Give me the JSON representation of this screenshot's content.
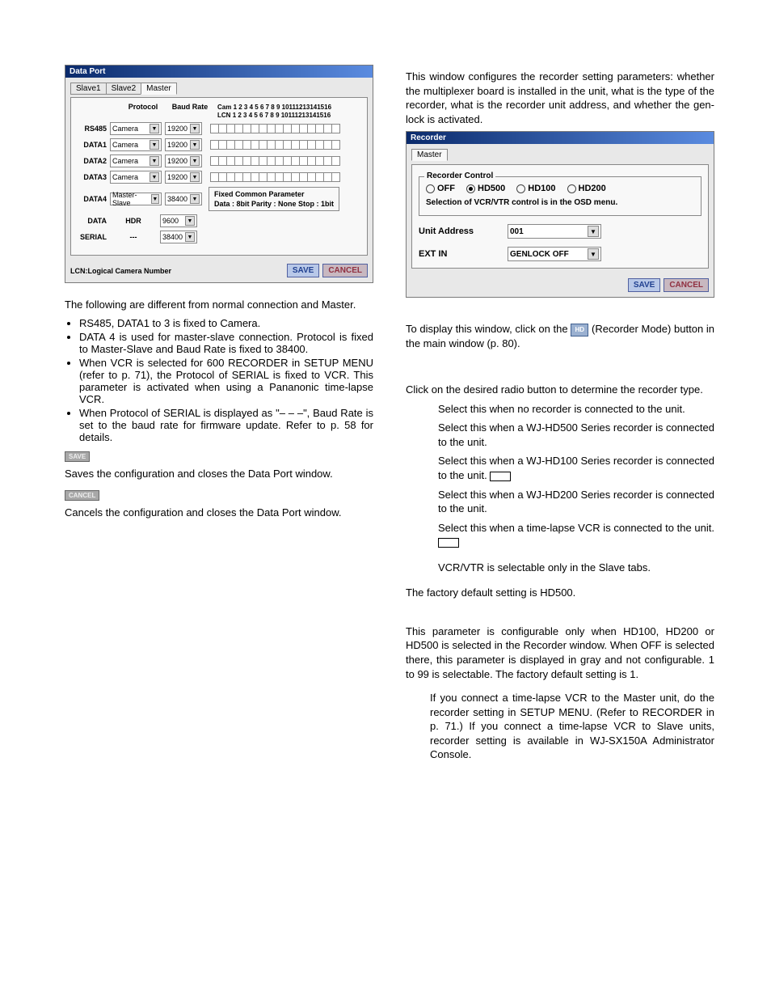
{
  "dataport_win": {
    "title": "Data Port",
    "tabs": [
      "Slave1",
      "Slave2",
      "Master"
    ],
    "headers": {
      "protocol": "Protocol",
      "baud": "Baud Rate",
      "cam": "Cam",
      "lcn": "LCN"
    },
    "cam_nums": "1  2  3  4  5  6  7  8  9 10111213141516",
    "rows": [
      {
        "label": "RS485",
        "protocol": "Camera",
        "baud": "19200",
        "lcn": true
      },
      {
        "label": "DATA1",
        "protocol": "Camera",
        "baud": "19200",
        "lcn": true
      },
      {
        "label": "DATA2",
        "protocol": "Camera",
        "baud": "19200",
        "lcn": true
      },
      {
        "label": "DATA3",
        "protocol": "Camera",
        "baud": "19200",
        "lcn": true
      },
      {
        "label": "DATA4",
        "protocol": "Master-Slave",
        "baud": "38400",
        "lcn": false
      },
      {
        "label": "DATA",
        "protocol": "HDR",
        "baud": "9600",
        "lcn": false
      },
      {
        "label": "SERIAL",
        "protocol": "---",
        "baud": "38400",
        "lcn": false
      }
    ],
    "fixed": {
      "title": "Fixed Common Parameter",
      "text": "Data : 8bit   Parity : None   Stop : 1bit"
    },
    "lcn_note": "LCN:Logical Camera Number",
    "save": "SAVE",
    "cancel": "CANCEL"
  },
  "left_text": {
    "intro": "The following are different from normal connection and Master.",
    "bullets": [
      "RS485, DATA1 to 3 is fixed to Camera.",
      "DATA 4 is used for master-slave connection. Protocol is fixed to Master-Slave and Baud Rate is fixed to 38400.",
      "When VCR is selected for 600 RECORDER in SETUP MENU (refer to p. 71), the Protocol of SERIAL is fixed to VCR. This parameter is activated when using a Pananonic time-lapse VCR.",
      "When Protocol of SERIAL is displayed as \"– – –\", Baud Rate is set to the baud rate for firmware update.\nRefer to p. 58 for details."
    ],
    "save_btn": "SAVE",
    "save_desc": "Saves the configuration and closes the Data Port window.",
    "cancel_btn": "CANCEL",
    "cancel_desc": "Cancels the configuration and closes the Data Port window."
  },
  "right_text": {
    "intro": "This window configures the recorder setting parameters: whether the multiplexer board is installed in the unit, what is the type of the recorder, what is the recorder unit address, and whether the gen-lock is activated."
  },
  "recorder_win": {
    "title": "Recorder",
    "tab": "Master",
    "frame_title": "Recorder Control",
    "radios": [
      "OFF",
      "HD500",
      "HD100",
      "HD200"
    ],
    "selected": "HD500",
    "sel_note": "Selection of VCR/VTR control is in the OSD menu.",
    "unit_addr_label": "Unit Address",
    "unit_addr_value": "001",
    "extin_label": "EXT IN",
    "extin_value": "GENLOCK OFF",
    "save": "SAVE",
    "cancel": "CANCEL"
  },
  "right_text2": {
    "display_a": "To display this window, click on the ",
    "icon_label": "HD",
    "display_b": " (Recorder Mode) button in the main window (p. 80).",
    "rc_intro": "Click on the desired radio button to determine the recorder type.",
    "opts": [
      "Select this when no recorder is connected to the unit.",
      "Select this when a WJ-HD500 Series recorder is connected to the unit.",
      "Select this when a WJ-HD100 Series recorder is connected to the unit.",
      "Select this when a WJ-HD200 Series recorder is connected to the unit.",
      "Select this when a time-lapse VCR is connected to the unit."
    ],
    "vcr_note": "VCR/VTR is selectable only in the Slave tabs.",
    "default_note": "The factory default setting is HD500.",
    "unit_para": "This parameter is configurable only when HD100, HD200 or HD500 is selected in the Recorder window. When OFF is selected there, this parameter is displayed in gray and not configurable. 1 to 99 is selectable. The factory default setting is 1.",
    "note": "If you connect a time-lapse VCR to the Master unit, do the recorder setting in SETUP MENU. (Refer to RECORDER in p. 71.) If you connect a time-lapse VCR to Slave units, recorder setting is available in WJ-SX150A Administrator Console."
  }
}
